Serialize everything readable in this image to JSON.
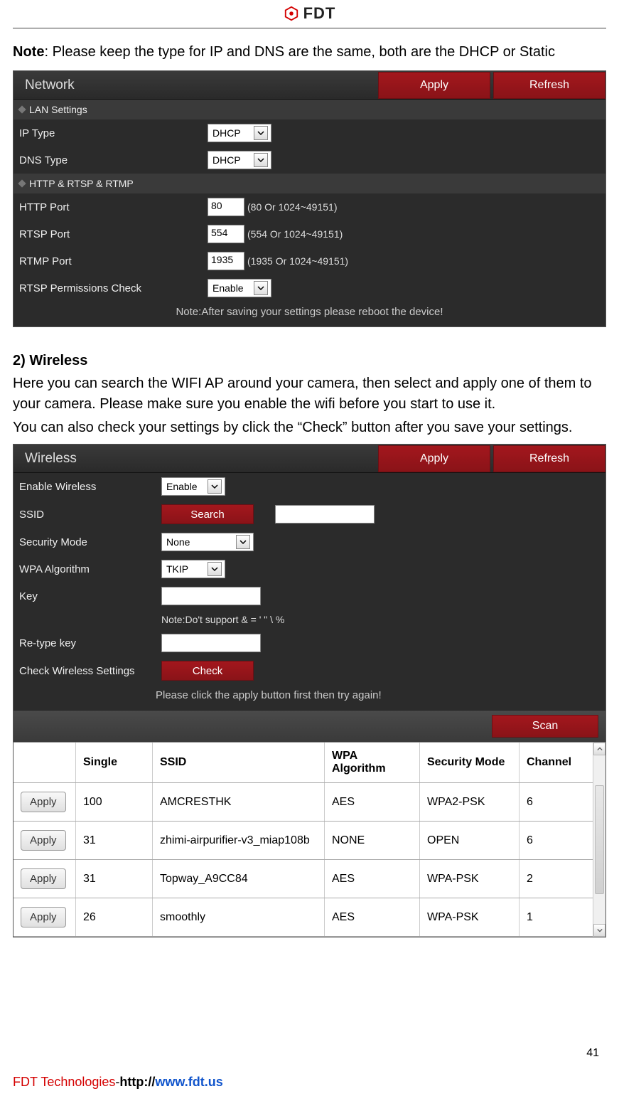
{
  "header": {
    "brand": "FDT"
  },
  "note_label": "Note",
  "note_text": ": Please keep the type for IP and DNS are the same, both are the DHCP or Static",
  "network_panel": {
    "title": "Network",
    "apply": "Apply",
    "refresh": "Refresh",
    "section_lan": "LAN Settings",
    "section_http": "HTTP & RTSP & RTMP",
    "rows": {
      "ip_type": {
        "label": "IP Type",
        "value": "DHCP"
      },
      "dns_type": {
        "label": "DNS Type",
        "value": "DHCP"
      },
      "http_port": {
        "label": "HTTP Port",
        "value": "80",
        "hint": "(80 Or 1024~49151)"
      },
      "rtsp_port": {
        "label": "RTSP Port",
        "value": "554",
        "hint": "(554 Or 1024~49151)"
      },
      "rtmp_port": {
        "label": "RTMP Port",
        "value": "1935",
        "hint": "(1935 Or 1024~49151)"
      },
      "rtsp_perm": {
        "label": "RTSP Permissions Check",
        "value": "Enable"
      }
    },
    "note": "Note:After saving your settings please reboot the device!"
  },
  "wireless_section": {
    "heading": "2) Wireless",
    "p1": "Here you can search the WIFI AP around your camera, then select and apply one of them to your camera. Please make sure you enable the wifi before you start to use it.",
    "p2": "You can also check your settings by click the “Check” button after you save your settings."
  },
  "wireless_panel": {
    "title": "Wireless",
    "apply": "Apply",
    "refresh": "Refresh",
    "rows": {
      "enable": {
        "label": "Enable Wireless",
        "value": "Enable"
      },
      "ssid": {
        "label": "SSID",
        "button": "Search",
        "value": ""
      },
      "security": {
        "label": "Security Mode",
        "value": "None"
      },
      "wpa": {
        "label": "WPA Algorithm",
        "value": "TKIP"
      },
      "key": {
        "label": "Key",
        "value": ""
      },
      "key_note": "Note:Do't support & = ' \" \\ %",
      "retype": {
        "label": "Re-type key",
        "value": ""
      },
      "check": {
        "label": "Check Wireless Settings",
        "button": "Check"
      }
    },
    "note": "Please click the apply button first then try again!",
    "scan": "Scan",
    "table": {
      "headers": {
        "apply": "",
        "single": "Single",
        "ssid": "SSID",
        "wpa": "WPA Algorithm",
        "mode": "Security Mode",
        "channel": "Channel"
      },
      "apply_label": "Apply",
      "rows": [
        {
          "single": "100",
          "ssid": "AMCRESTHK",
          "wpa": "AES",
          "mode": "WPA2-PSK",
          "channel": "6"
        },
        {
          "single": "31",
          "ssid": "zhimi-airpurifier-v3_miap108b",
          "wpa": "NONE",
          "mode": "OPEN",
          "channel": "6"
        },
        {
          "single": "31",
          "ssid": "Topway_A9CC84",
          "wpa": "AES",
          "mode": "WPA-PSK",
          "channel": "2"
        },
        {
          "single": "26",
          "ssid": "smoothly",
          "wpa": "AES",
          "mode": "WPA-PSK",
          "channel": "1"
        }
      ]
    }
  },
  "footer": {
    "company": "FDT Technologies",
    "dash": "-",
    "url_prefix": "http://",
    "url": "www.fdt.us",
    "page_num": "41"
  }
}
